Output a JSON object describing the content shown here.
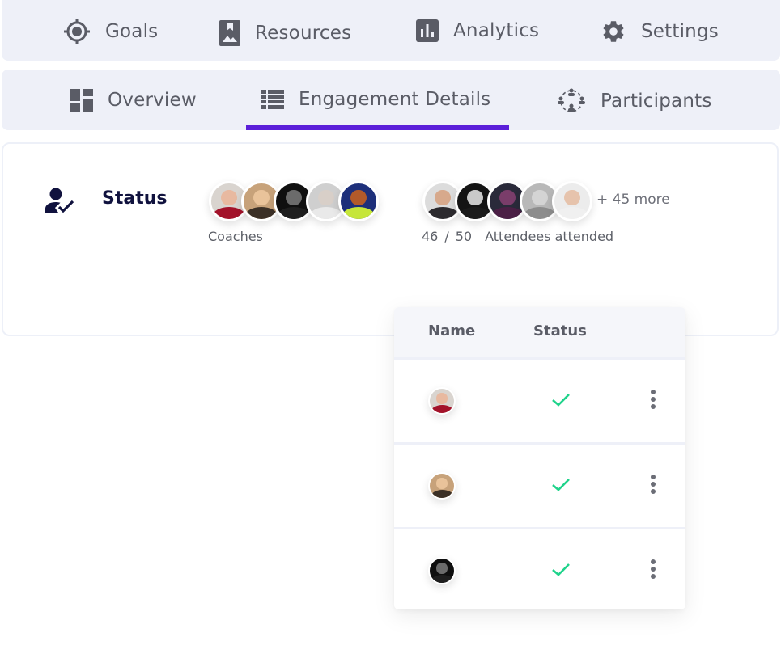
{
  "top_nav": {
    "items": [
      {
        "label": "Goals",
        "icon": "crosshair-target-icon"
      },
      {
        "label": "Resources",
        "icon": "bookmark-image-icon"
      },
      {
        "label": "Analytics",
        "icon": "bar-chart-icon"
      },
      {
        "label": "Settings",
        "icon": "gear-icon"
      }
    ]
  },
  "tabs": {
    "items": [
      {
        "label": "Overview",
        "icon": "dashboard-grid-icon"
      },
      {
        "label": "Engagement Details",
        "icon": "list-icon",
        "active": true
      },
      {
        "label": "Participants",
        "icon": "group-circle-icon"
      }
    ],
    "active_color": "#5b1fd9"
  },
  "status_card": {
    "title": "Status",
    "coaches_label": "Coaches",
    "coaches": [
      {
        "face": "#e8b9a0",
        "body": "#a3122a",
        "bg": "#d9d4cf"
      },
      {
        "face": "#e9c39a",
        "body": "#3b3026",
        "bg": "#c7a27a"
      },
      {
        "face": "#6b6b6b",
        "body": "#1e1e1e",
        "bg": "#0f0f0f"
      },
      {
        "face": "#d8cfc8",
        "body": "#e9e9e9",
        "bg": "#cfcfcf"
      },
      {
        "face": "#b25a2a",
        "body": "#c6e63a",
        "bg": "#1d2f7a"
      }
    ],
    "attendees": [
      {
        "face": "#d7a98c",
        "body": "#2c2a2e",
        "bg": "#dcdcdc"
      },
      {
        "face": "#c9c9c9",
        "body": "#1b1b1b",
        "bg": "#141414"
      },
      {
        "face": "#7a3d6a",
        "body": "#4b1f45",
        "bg": "#2a2a3a"
      },
      {
        "face": "#d4d4d4",
        "body": "#8d8d8d",
        "bg": "#b8b8b8"
      },
      {
        "face": "#e6c3ac",
        "body": "#f0f0f0",
        "bg": "#ececec"
      }
    ],
    "more_label": "+ 45 more",
    "attended_count": "46",
    "attended_sep": "/",
    "attended_total": "50",
    "attended_label": "Attendees attended"
  },
  "popup_table": {
    "headers": {
      "name": "Name",
      "status": "Status"
    },
    "rows": [
      {
        "avatar": {
          "face": "#e8b9a0",
          "body": "#a3122a",
          "bg": "#d9d4cf"
        },
        "status": "check-icon"
      },
      {
        "avatar": {
          "face": "#e9c39a",
          "body": "#3b3026",
          "bg": "#c7a27a"
        },
        "status": "check-icon"
      },
      {
        "avatar": {
          "face": "#6b6b6b",
          "body": "#1e1e1e",
          "bg": "#0f0f0f"
        },
        "status": "check-icon"
      }
    ],
    "check_color": "#1fd38b"
  }
}
